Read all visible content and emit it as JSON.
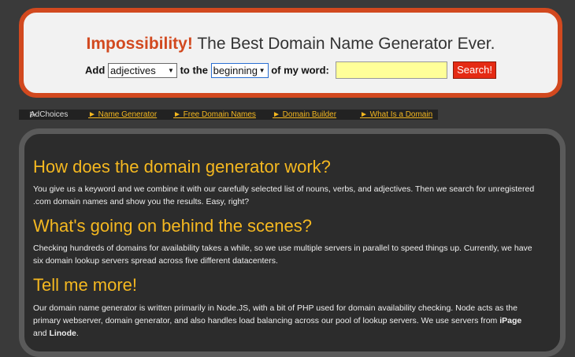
{
  "header": {
    "brand": "Impossibility!",
    "tagline": " The Best Domain Name Generator Ever.",
    "form": {
      "add_label": "Add",
      "type_value": "adjectives",
      "to_label": "to the",
      "position_value": "beginning",
      "word_label": "of my word:",
      "word_value": "",
      "search_label": "Search!"
    }
  },
  "nav": {
    "adchoices": "AdChoices",
    "adchoices_icon": "play-triangle",
    "links": [
      "► Name Generator",
      "► Free Domain Names",
      "► Domain Builder",
      "► What Is a Domain"
    ]
  },
  "content": {
    "sections": [
      {
        "heading": "How does the domain generator work?",
        "body": "You give us a keyword and we combine it with our carefully selected list of nouns, verbs, and adjectives. Then we search for unregistered .com domain names and show you the results. Easy, right?"
      },
      {
        "heading": "What's going on behind the scenes?",
        "body": "Checking hundreds of domains for availability takes a while, so we use multiple servers in parallel to speed things up. Currently, we have six domain lookup servers spread across five different datacenters."
      },
      {
        "heading": "Tell me more!",
        "body_prefix": "Our domain name generator is written primarily in Node.JS, with a bit of PHP used for domain availability checking. Node acts as the primary webserver, domain generator, and also handles load balancing across our pool of lookup servers. We use servers from ",
        "bold_1": "iPage",
        "and": " and ",
        "bold_2": "Linode",
        "end": "."
      }
    ]
  },
  "colors": {
    "accent": "#d2491f",
    "heading": "#f5b820",
    "link": "#f5b820",
    "input_bg": "#ffff99",
    "button": "#e52b14"
  }
}
